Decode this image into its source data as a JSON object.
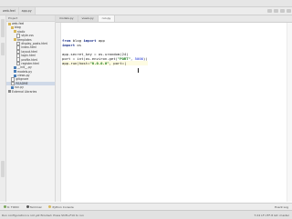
{
  "toolbar": {
    "project_tab": "web-feel",
    "app_tab": "app.py"
  },
  "project": {
    "header": "Project",
    "tree": [
      {
        "label": "web-feel",
        "kind": "folder",
        "indent": 0
      },
      {
        "label": "blog",
        "kind": "folder",
        "indent": 1
      },
      {
        "label": "static",
        "kind": "folder",
        "indent": 2
      },
      {
        "label": "style.css",
        "kind": "file",
        "indent": 3
      },
      {
        "label": "templates",
        "kind": "folder",
        "indent": 2
      },
      {
        "label": "display_posts.html",
        "kind": "file",
        "indent": 3
      },
      {
        "label": "index.html",
        "kind": "file",
        "indent": 3
      },
      {
        "label": "layout.html",
        "kind": "file",
        "indent": 3
      },
      {
        "label": "login.html",
        "kind": "file",
        "indent": 3
      },
      {
        "label": "profile.html",
        "kind": "file",
        "indent": 3
      },
      {
        "label": "register.html",
        "kind": "file",
        "indent": 3
      },
      {
        "label": "__init__.py",
        "kind": "py",
        "indent": 2
      },
      {
        "label": "models.py",
        "kind": "py",
        "indent": 2
      },
      {
        "label": "views.py",
        "kind": "py",
        "indent": 2
      },
      {
        "label": "gitignore",
        "kind": "file",
        "indent": 1
      },
      {
        "label": "README",
        "kind": "file",
        "indent": 1,
        "selected": true
      },
      {
        "label": "run.py",
        "kind": "py",
        "indent": 1
      },
      {
        "label": "External Libraries",
        "kind": "lib",
        "indent": 0
      }
    ]
  },
  "editor": {
    "tabs": [
      "models.py",
      "views.py",
      "run.py"
    ],
    "active_tab": 2
  },
  "code": {
    "l1_from": "from",
    "l1_mid": " blog ",
    "l1_import": "import",
    "l1_tail": " app",
    "l2_import": "import",
    "l2_tail": " os",
    "l4": "app.secret_key = os.urandom(24)",
    "l5_pre": "port = int(os.environ.get(",
    "l5_str": "\"PORT\"",
    "l5_mid": ", ",
    "l5_num": "5000",
    "l5_tail": "))",
    "l6_pre": "app.run(host=",
    "l6_str": "\"0.0.0.0\"",
    "l6_tail": ", port=|"
  },
  "bottom_tabs": [
    "6: TODO",
    "Terminal",
    "Python Console"
  ],
  "bottom_right": "Event Log",
  "status": {
    "message": "Run configuration is not yet finished. Press Shift+F10 to run",
    "position": "7:24  LF  UTF-8  Git: master"
  }
}
